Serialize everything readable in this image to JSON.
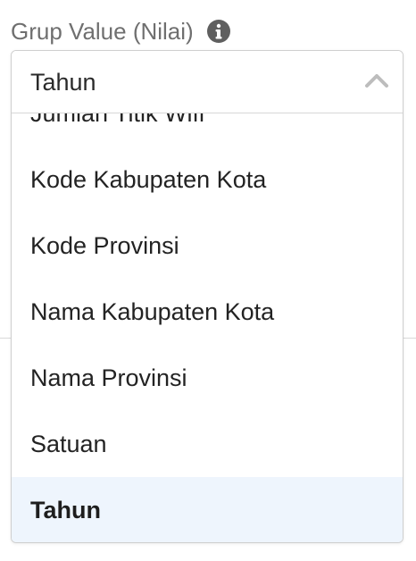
{
  "field": {
    "label": "Grup Value (Nilai)",
    "info_icon": "info-icon"
  },
  "select": {
    "value": "Tahun",
    "chevron_icon": "chevron-up-icon",
    "expanded": true
  },
  "options": [
    {
      "label": "Jumlah Titik Wifi",
      "selected": false
    },
    {
      "label": "Kode Kabupaten Kota",
      "selected": false
    },
    {
      "label": "Kode Provinsi",
      "selected": false
    },
    {
      "label": "Nama Kabupaten Kota",
      "selected": false
    },
    {
      "label": "Nama Provinsi",
      "selected": false
    },
    {
      "label": "Satuan",
      "selected": false
    },
    {
      "label": "Tahun",
      "selected": true
    }
  ],
  "colors": {
    "label_text": "#6f6f6f",
    "option_text": "#232323",
    "selected_background": "#eef5fd",
    "border": "#cfcfcf",
    "icon": "#5f5f5f"
  }
}
